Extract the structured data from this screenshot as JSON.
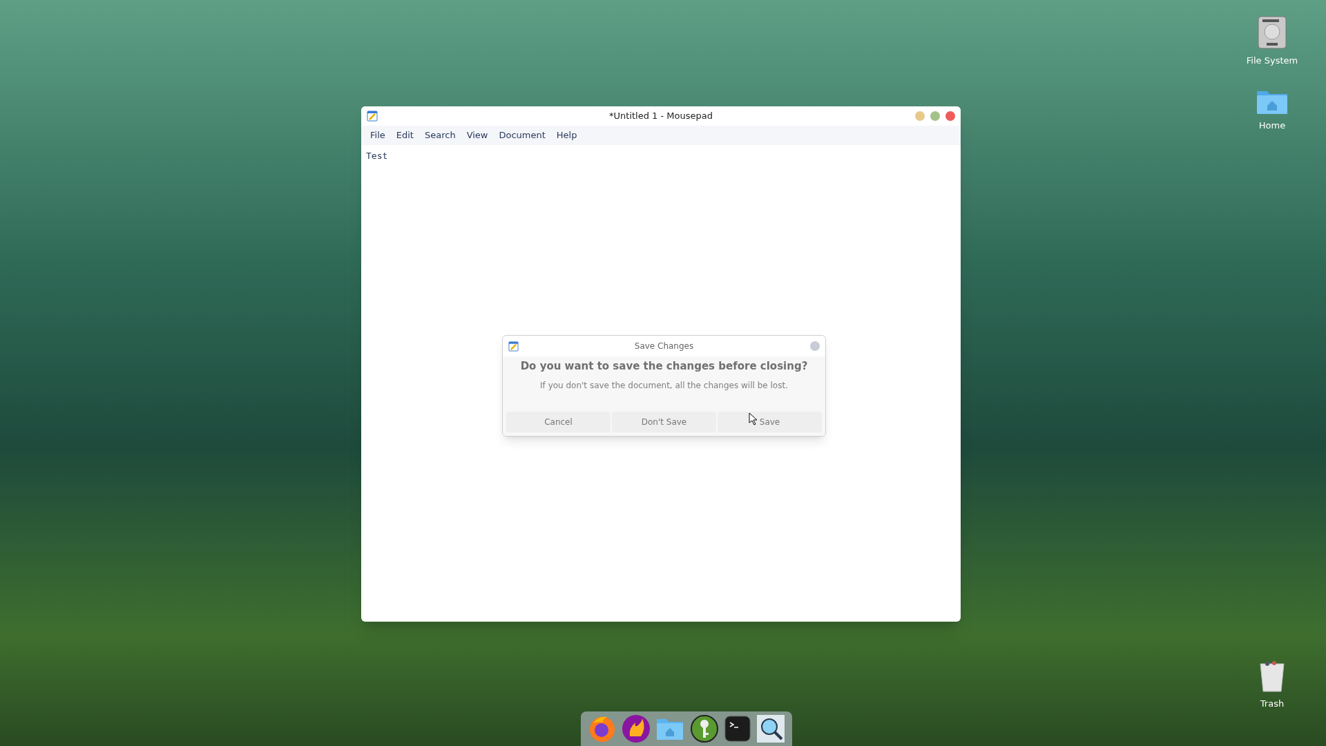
{
  "desktop_icons": [
    {
      "label": "File System",
      "kind": "drive"
    },
    {
      "label": "Home",
      "kind": "home"
    },
    {
      "label": "Trash",
      "kind": "trash"
    }
  ],
  "window": {
    "title": "*Untitled 1 - Mousepad",
    "menu": [
      "File",
      "Edit",
      "Search",
      "View",
      "Document",
      "Help"
    ],
    "text": "Test"
  },
  "dialog": {
    "title": "Save Changes",
    "heading": "Do you want to save the changes before closing?",
    "message": "If you don't save the document, all the changes will be lost.",
    "buttons": [
      "Cancel",
      "Don't Save",
      "Save"
    ]
  }
}
